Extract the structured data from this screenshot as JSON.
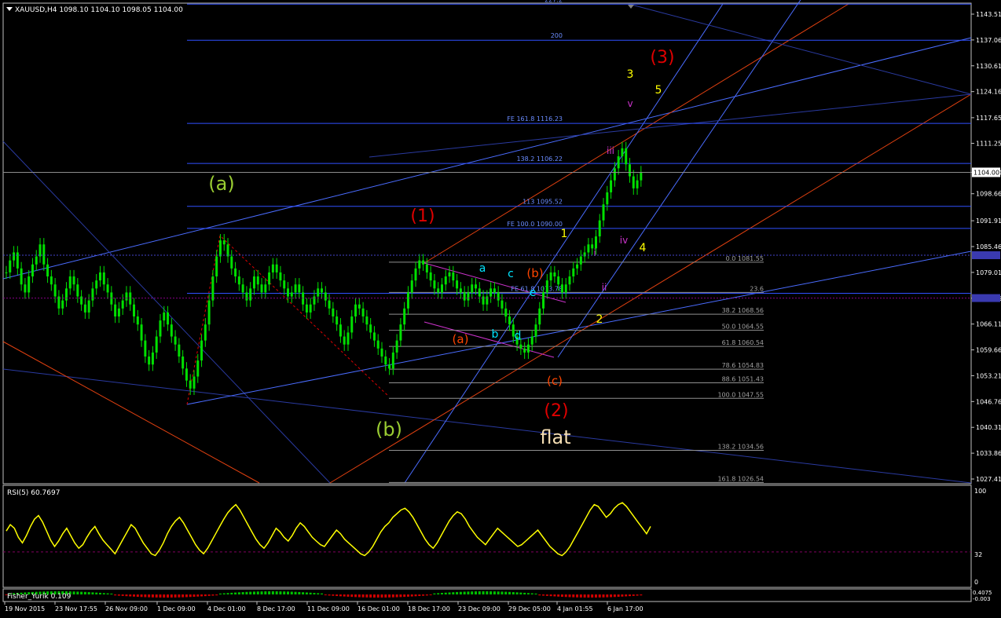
{
  "chart_data": {
    "type": "candlestick",
    "header": "XAUUSD,H4  1098.10 1104.10 1098.05 1104.00",
    "price_axis": {
      "ticks": [
        "1143.51",
        "1137.06",
        "1130.61",
        "1124.16",
        "1117.65",
        "1111.25",
        "1104.00",
        "1098.66",
        "1091.91",
        "1085.46",
        "1079.01",
        "1072.56",
        "1066.11",
        "1059.66",
        "1053.21",
        "1046.76",
        "1040.31",
        "1033.86",
        "1027.41"
      ],
      "current_price": "1104.00",
      "range": [
        1024,
        1147
      ]
    },
    "time_axis": {
      "labels": [
        "19 Nov 2015",
        "23 Nov 17:55",
        "26 Nov 09:00",
        "1 Dec 09:00",
        "4 Dec 01:00",
        "8 Dec 17:00",
        "11 Dec 09:00",
        "16 Dec 01:00",
        "18 Dec 17:00",
        "23 Dec 09:00",
        "29 Dec 05:00",
        "4 Jan 01:55",
        "6 Jan 17:00"
      ]
    },
    "fibo_ext_levels": [
      {
        "label": "227.2",
        "price": 1146
      },
      {
        "label": "200",
        "price": 1137
      },
      {
        "label": "FE 161.8 1116.23",
        "price": 1116.23
      },
      {
        "label": "138.2 1106.22",
        "price": 1106.22
      },
      {
        "label": "113 1095.52",
        "price": 1095.52
      },
      {
        "label": "FE 100.0 1090.00",
        "price": 1090.0
      },
      {
        "label": "FE 61.8 1073.78",
        "price": 1073.78
      }
    ],
    "fibo_ret_levels": [
      {
        "label": "0.0 1081.55",
        "price": 1081.55
      },
      {
        "label": "23.6",
        "price": 1074
      },
      {
        "label": "38.2 1068.56",
        "price": 1068.56
      },
      {
        "label": "50.0 1064.55",
        "price": 1064.55
      },
      {
        "label": "61.8 1060.54",
        "price": 1060.54
      },
      {
        "label": "78.6 1054.83",
        "price": 1054.83
      },
      {
        "label": "88.6 1051.43",
        "price": 1051.43
      },
      {
        "label": "100.0 1047.55",
        "price": 1047.55
      },
      {
        "label": "138.2 1034.56",
        "price": 1034.56
      },
      {
        "label": "161.8 1026.54",
        "price": 1026.54
      }
    ],
    "wave_labels": [
      {
        "text": "(a)",
        "color": "#9acd32"
      },
      {
        "text": "(b)",
        "color": "#9acd32"
      },
      {
        "text": "(1)",
        "color": "#e00000"
      },
      {
        "text": "(2)",
        "color": "#e00000"
      },
      {
        "text": "(3)",
        "color": "#e00000"
      },
      {
        "text": "flat",
        "color": "#f5deb3"
      },
      {
        "text": "a",
        "color": "#00e5ff"
      },
      {
        "text": "b",
        "color": "#00e5ff"
      },
      {
        "text": "c",
        "color": "#00e5ff"
      },
      {
        "text": "d",
        "color": "#00e5ff"
      },
      {
        "text": "e",
        "color": "#00e5ff"
      },
      {
        "text": "(a)",
        "color": "#ff4500"
      },
      {
        "text": "(b)",
        "color": "#ff4500"
      },
      {
        "text": "(c)",
        "color": "#ff4500"
      },
      {
        "text": "1",
        "color": "#ffff00"
      },
      {
        "text": "2",
        "color": "#ffff00"
      },
      {
        "text": "3",
        "color": "#ffff00"
      },
      {
        "text": "4",
        "color": "#ffff00"
      },
      {
        "text": "5",
        "color": "#ffff00"
      },
      {
        "text": "i",
        "color": "#cc33cc"
      },
      {
        "text": "ii",
        "color": "#cc33cc"
      },
      {
        "text": "iii",
        "color": "#cc33cc"
      },
      {
        "text": "iv",
        "color": "#cc33cc"
      },
      {
        "text": "v",
        "color": "#cc33cc"
      }
    ],
    "closes": [
      1079,
      1082,
      1084,
      1080,
      1076,
      1074,
      1078,
      1081,
      1083,
      1086,
      1081,
      1078,
      1076,
      1073,
      1070,
      1072,
      1075,
      1078,
      1076,
      1073,
      1071,
      1069,
      1072,
      1075,
      1077,
      1079,
      1076,
      1074,
      1071,
      1068,
      1070,
      1072,
      1074,
      1071,
      1068,
      1066,
      1062,
      1058,
      1056,
      1059,
      1063,
      1067,
      1069,
      1066,
      1063,
      1061,
      1058,
      1055,
      1052,
      1050,
      1053,
      1057,
      1062,
      1066,
      1072,
      1078,
      1083,
      1087,
      1086,
      1083,
      1080,
      1078,
      1076,
      1074,
      1072,
      1075,
      1078,
      1076,
      1074,
      1076,
      1079,
      1081,
      1079,
      1077,
      1075,
      1073,
      1074,
      1076,
      1074,
      1071,
      1069,
      1071,
      1073,
      1075,
      1074,
      1072,
      1070,
      1068,
      1066,
      1063,
      1061,
      1064,
      1068,
      1071,
      1070,
      1068,
      1066,
      1064,
      1062,
      1060,
      1058,
      1056,
      1055,
      1059,
      1062,
      1066,
      1070,
      1074,
      1077,
      1080,
      1082,
      1081,
      1079,
      1077,
      1075,
      1074,
      1076,
      1078,
      1079,
      1077,
      1075,
      1074,
      1072,
      1074,
      1076,
      1075,
      1073,
      1071,
      1073,
      1075,
      1074,
      1072,
      1070,
      1068,
      1066,
      1063,
      1061,
      1060,
      1059,
      1061,
      1063,
      1066,
      1070,
      1074,
      1077,
      1079,
      1078,
      1076,
      1074,
      1076,
      1078,
      1080,
      1081,
      1083,
      1084,
      1086,
      1085,
      1088,
      1092,
      1096,
      1099,
      1102,
      1105,
      1108,
      1110,
      1106,
      1103,
      1100,
      1102,
      1104
    ],
    "rsi": {
      "label": "RSI(5) 60.7697",
      "scale_top": "100",
      "level": "32",
      "scale_bottom": "0",
      "values": [
        55,
        62,
        58,
        48,
        42,
        50,
        60,
        68,
        72,
        65,
        55,
        45,
        38,
        44,
        52,
        58,
        50,
        42,
        36,
        40,
        48,
        55,
        60,
        52,
        45,
        40,
        35,
        30,
        38,
        46,
        54,
        62,
        58,
        50,
        42,
        36,
        30,
        28,
        34,
        42,
        52,
        60,
        66,
        70,
        64,
        56,
        48,
        40,
        34,
        30,
        36,
        44,
        52,
        60,
        68,
        75,
        80,
        84,
        78,
        70,
        62,
        54,
        46,
        40,
        36,
        42,
        50,
        58,
        54,
        48,
        44,
        50,
        58,
        64,
        60,
        54,
        48,
        44,
        40,
        38,
        44,
        50,
        56,
        52,
        46,
        42,
        38,
        34,
        30,
        28,
        32,
        38,
        46,
        54,
        60,
        64,
        70,
        74,
        78,
        80,
        76,
        70,
        62,
        54,
        46,
        40,
        36,
        42,
        50,
        58,
        66,
        72,
        76,
        74,
        68,
        60,
        54,
        48,
        44,
        40,
        46,
        52,
        58,
        54,
        50,
        46,
        42,
        38,
        40,
        44,
        48,
        52,
        56,
        50,
        44,
        38,
        34,
        30,
        28,
        32,
        38,
        46,
        54,
        62,
        70,
        78,
        84,
        82,
        76,
        70,
        74,
        80,
        84,
        86,
        82,
        76,
        70,
        64,
        58,
        52,
        60
      ]
    },
    "fisher": {
      "label": "Fisher_Yurik 0.109",
      "scale_top": "0.4075",
      "scale_bottom": "-0.003"
    }
  }
}
